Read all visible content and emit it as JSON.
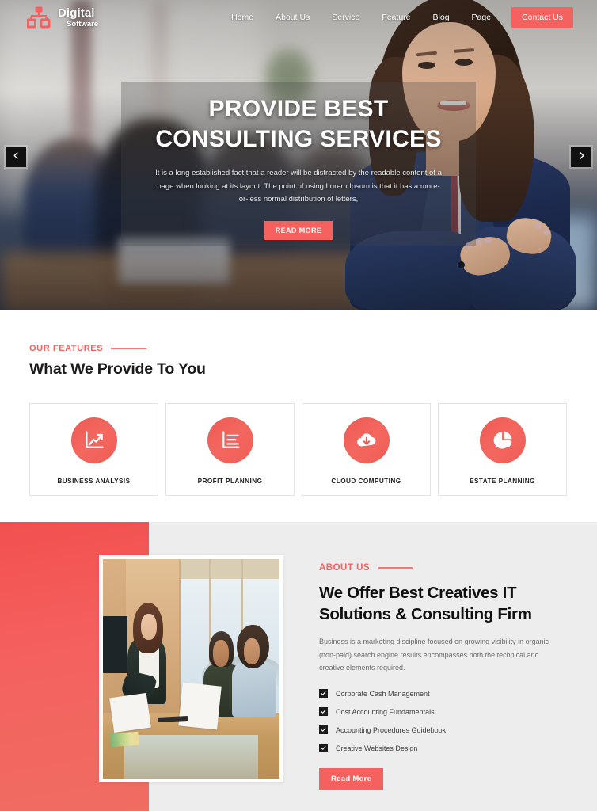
{
  "header": {
    "logo": {
      "icon": "sitemap-icon",
      "main": "Digital",
      "sub": "Software"
    },
    "nav": [
      {
        "label": "Home",
        "name": "nav-home"
      },
      {
        "label": "About Us",
        "name": "nav-about-us"
      },
      {
        "label": "Service",
        "name": "nav-service"
      },
      {
        "label": "Feature",
        "name": "nav-feature"
      },
      {
        "label": "Blog",
        "name": "nav-blog"
      },
      {
        "label": "Page",
        "name": "nav-page"
      }
    ],
    "cta_label": "Contact Us"
  },
  "hero": {
    "title_line1": "PROVIDE BEST",
    "title_line2": "CONSULTING SERVICES",
    "description": "It is a long established fact that a reader will be distracted by the readable content of a page when looking at its layout. The point of using Lorem Ipsum is that it has a more-or-less normal distribution of letters,",
    "button_label": "READ MORE",
    "prev_arrow": "chevron-left-icon",
    "next_arrow": "chevron-right-icon"
  },
  "features": {
    "eyebrow": "OUR FEATURES",
    "heading": "What We Provide To You",
    "cards": [
      {
        "title": "BUSINESS ANALYSIS",
        "icon": "line-chart-icon"
      },
      {
        "title": "PROFIT PLANNING",
        "icon": "bar-chart-icon"
      },
      {
        "title": "CLOUD COMPUTING",
        "icon": "cloud-download-icon"
      },
      {
        "title": "ESTATE PLANNING",
        "icon": "pie-chart-icon"
      }
    ]
  },
  "about": {
    "eyebrow": "ABOUT US",
    "heading_line1": "We Offer Best Creatives IT",
    "heading_line2": "Solutions & Consulting Firm",
    "description": "Business is a marketing discipline focused on growing visibility in organic (non-paid) search engine results.encompasses both the technical and creative elements required.",
    "checklist": [
      "Corporate Cash Management",
      "Cost Accounting Fundamentals",
      "Accounting Procedures Guidebook",
      "Creative Websites Design"
    ],
    "button_label": "Read  More",
    "image_alt": "team-meeting-photo"
  },
  "colors": {
    "accent": "#f4615f",
    "accent_dark": "#ee5a52",
    "heading": "#101010",
    "body_text": "#6c6c6c",
    "about_bg": "#ededed",
    "card_border": "#e3e3e3"
  }
}
